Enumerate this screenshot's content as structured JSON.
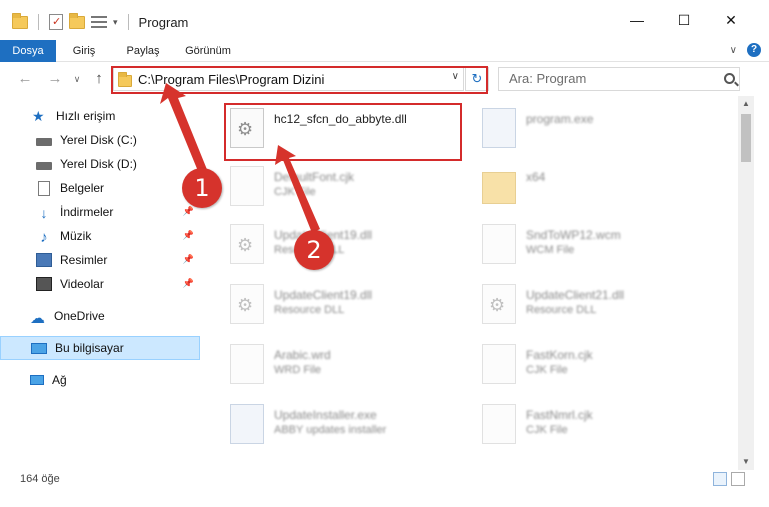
{
  "window": {
    "title": "Program",
    "minimize_label": "—",
    "maximize_label": "☐",
    "close_label": "✕"
  },
  "ribbon": {
    "tabs": [
      "Dosya",
      "Giriş",
      "Paylaş",
      "Görünüm"
    ],
    "help_label": "?",
    "expand_label": "∨"
  },
  "nav": {
    "back": "←",
    "forward": "→",
    "recent": "∨",
    "up": "↑",
    "address": "C:\\Program Files\\Program Dizini",
    "refresh": "↻",
    "search_placeholder": "Ara: Program"
  },
  "sidebar": {
    "items": [
      {
        "label": "Hızlı erişim",
        "icon": "star-icon"
      },
      {
        "label": "Yerel Disk (C:)",
        "icon": "drive-icon"
      },
      {
        "label": "Yerel Disk (D:)",
        "icon": "drive-icon"
      },
      {
        "label": "Belgeler",
        "icon": "document-icon"
      },
      {
        "label": "İndirmeler",
        "icon": "download-icon"
      },
      {
        "label": "Müzik",
        "icon": "music-icon"
      },
      {
        "label": "Resimler",
        "icon": "pictures-icon"
      },
      {
        "label": "Videolar",
        "icon": "video-icon"
      },
      {
        "label": "OneDrive",
        "icon": "cloud-icon"
      },
      {
        "label": "Bu bilgisayar",
        "icon": "computer-icon"
      },
      {
        "label": "Ağ",
        "icon": "network-icon"
      }
    ]
  },
  "files": [
    {
      "name": "hc12_sfcn_do_abbyte.dll",
      "desc": ""
    },
    {
      "name": "program.exe",
      "desc": ""
    },
    {
      "name": "DefaultFont.cjk",
      "desc": "CJK File"
    },
    {
      "name": "x64",
      "desc": ""
    },
    {
      "name": "UpdateClient19.dll",
      "desc": "Resource DLL"
    },
    {
      "name": "SndToWP12.wcm",
      "desc": "WCM File"
    },
    {
      "name": "UpdateClient19.dll",
      "desc": "Resource DLL"
    },
    {
      "name": "UpdateClient21.dll",
      "desc": "Resource DLL"
    },
    {
      "name": "Arabic.wrd",
      "desc": "WRD File"
    },
    {
      "name": "FastKorn.cjk",
      "desc": "CJK File"
    },
    {
      "name": "UpdateInstaller.exe",
      "desc": "ABBY updates installer"
    },
    {
      "name": "FastNmrl.cjk",
      "desc": "CJK File"
    }
  ],
  "status": {
    "count": "164 öğe"
  },
  "callouts": {
    "one": "1",
    "two": "2"
  },
  "colors": {
    "accent": "#1e6fc1",
    "highlight": "#d42b2b",
    "selection": "#cce8ff"
  }
}
